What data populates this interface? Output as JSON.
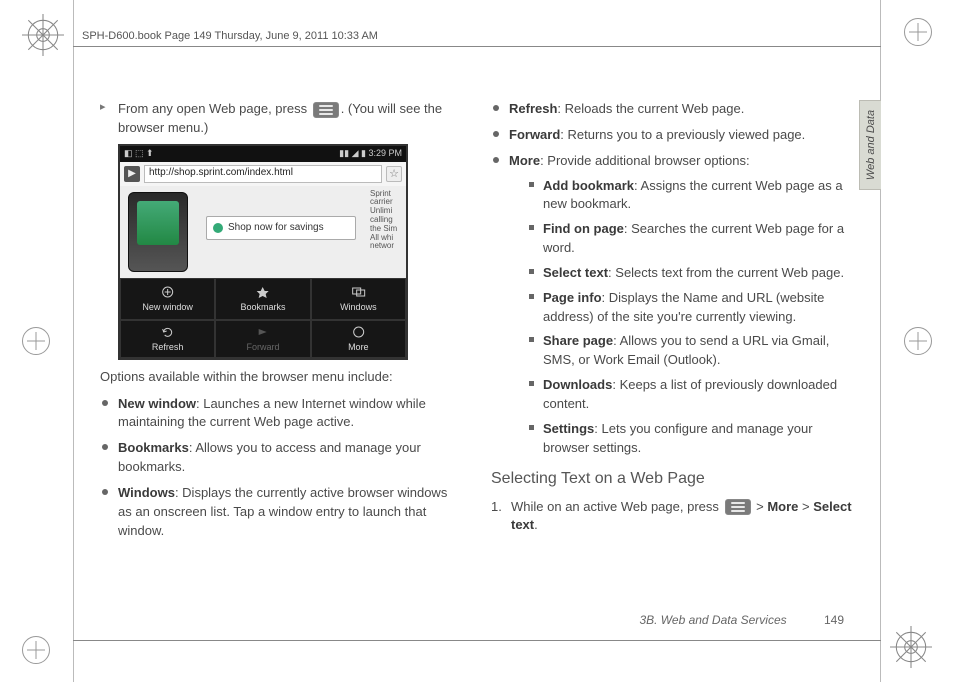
{
  "header_line": "SPH-D600.book  Page 149  Thursday, June 9, 2011  10:33 AM",
  "side_tab": "Web and Data",
  "col_left": {
    "intro_prefix": "From any open Web page, press ",
    "intro_suffix": ". (You will see the browser menu.)",
    "shot": {
      "time": "3:29 PM",
      "url": "http://shop.sprint.com/index.html",
      "banner": "Shop now for savings",
      "sidetext": "Sprint carrier Unlimi calling the Sim All whi networ",
      "menu": [
        "New window",
        "Bookmarks",
        "Windows",
        "Refresh",
        "Forward",
        "More"
      ]
    },
    "after_shot": "Options available within the browser menu include:",
    "items": [
      {
        "b": "New window",
        "t": ": Launches a new Internet window while maintaining the current Web page active."
      },
      {
        "b": "Bookmarks",
        "t": ": Allows you to access and manage your bookmarks."
      },
      {
        "b": "Windows",
        "t": ": Displays the currently active browser windows as an onscreen list. Tap a window entry to launch that window."
      }
    ]
  },
  "col_right": {
    "top_items": [
      {
        "b": "Refresh",
        "t": ": Reloads the current Web page."
      },
      {
        "b": "Forward",
        "t": ": Returns you to a previously viewed page."
      },
      {
        "b": "More",
        "t": ": Provide additional browser options:"
      }
    ],
    "more_items": [
      {
        "b": "Add bookmark",
        "t": ": Assigns the current Web page as a new bookmark."
      },
      {
        "b": "Find on page",
        "t": ": Searches the current Web page for a word."
      },
      {
        "b": "Select text",
        "t": ": Selects text from the current Web page."
      },
      {
        "b": "Page info",
        "t": ": Displays the Name and URL (website address) of the site you're currently viewing."
      },
      {
        "b": "Share page",
        "t": ": Allows you to send a URL via Gmail, SMS, or Work Email (Outlook)."
      },
      {
        "b": "Downloads",
        "t": ": Keeps a list of previously downloaded content."
      },
      {
        "b": "Settings",
        "t": ": Lets you configure and manage your browser settings."
      }
    ],
    "subhead": "Selecting Text on a Web Page",
    "step1_prefix": "While on an active Web page, press ",
    "step1_gt1": " > ",
    "step1_more": "More",
    "step1_gt2": " > ",
    "step1_sel": "Select text",
    "step1_end": "."
  },
  "footer": {
    "section": "3B. Web and Data Services",
    "page": "149"
  }
}
